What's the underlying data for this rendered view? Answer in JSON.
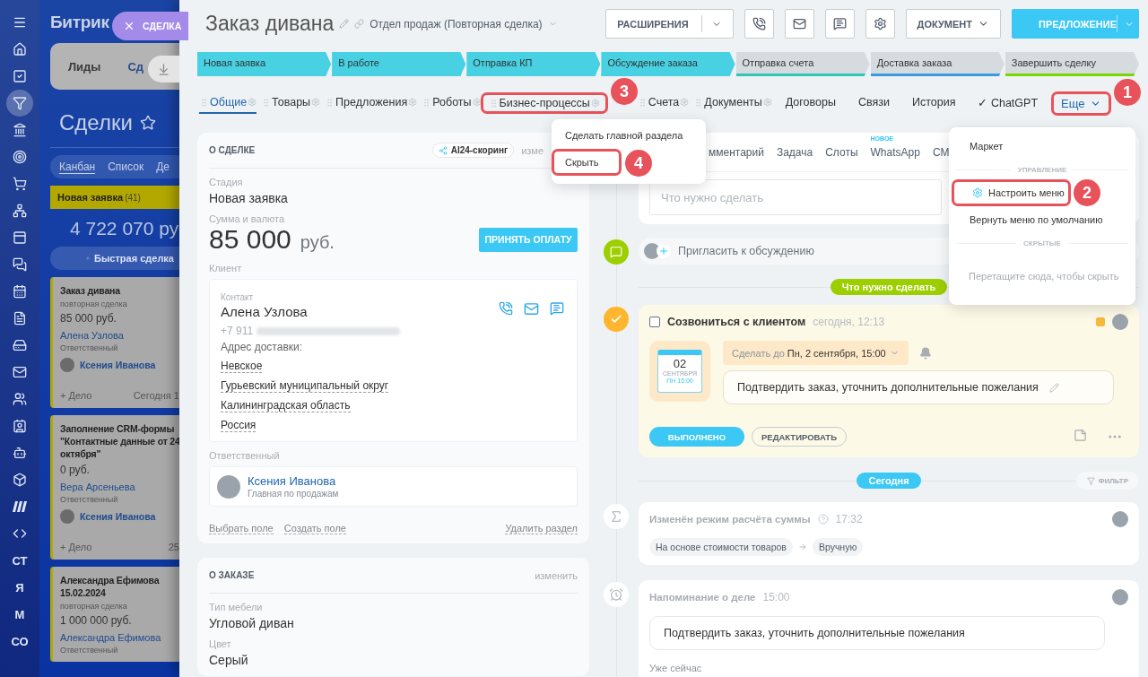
{
  "background_page": {
    "logo": "Битрик",
    "close_tab": {
      "label": "СДЕЛКА"
    },
    "rail": [
      {
        "kind": "icon",
        "selected": false
      },
      {
        "kind": "icon",
        "selected": false
      },
      {
        "kind": "icon",
        "selected": false
      },
      {
        "kind": "icon",
        "selected": true
      },
      {
        "kind": "icon",
        "selected": false
      },
      {
        "kind": "icon",
        "selected": false
      },
      {
        "kind": "icon",
        "selected": false
      },
      {
        "kind": "icon",
        "selected": false
      },
      {
        "kind": "icon",
        "selected": false
      },
      {
        "kind": "icon",
        "selected": false
      },
      {
        "kind": "icon",
        "selected": false
      },
      {
        "kind": "icon",
        "selected": false
      },
      {
        "kind": "icon",
        "selected": false
      },
      {
        "kind": "icon",
        "selected": false
      },
      {
        "kind": "icon",
        "selected": false
      },
      {
        "kind": "icon",
        "selected": false
      },
      {
        "kind": "icon",
        "selected": false
      },
      {
        "kind": "icon",
        "selected": false
      },
      {
        "kind": "icon",
        "selected": false
      },
      {
        "kind": "icon",
        "selected": false
      },
      {
        "kind": "text",
        "label": "СТ",
        "selected": false
      },
      {
        "kind": "text",
        "label": "Я",
        "selected": false
      },
      {
        "kind": "text",
        "label": "М",
        "selected": false
      },
      {
        "kind": "text",
        "label": "СО",
        "selected": false
      }
    ],
    "entity_tabs": [
      {
        "label": "Лиды",
        "selected": false
      },
      {
        "label": "Сд",
        "selected": true
      }
    ],
    "title": "Сделки",
    "view_tabs": [
      {
        "label": "Канбан",
        "selected": true
      },
      {
        "label": "Список",
        "selected": false
      },
      {
        "label": "Де",
        "selected": false
      }
    ],
    "column": {
      "title": "Новая заявка",
      "count": "(41)",
      "total": "4 722 070 ру",
      "quick_add": "Быстрая сделка"
    },
    "cards": [
      {
        "title_lines": [
          "Заказ дивана"
        ],
        "subtitle": "повторная сделка",
        "amount": "85 000 руб.",
        "client": "Алена Узлова",
        "responsible_label": "Ответственный",
        "responsible": "Ксения Иванова",
        "add": "+ Дело",
        "date": "Сегодня 1"
      },
      {
        "title_lines": [
          "Заполнение CRM-формы",
          "\"Контактные данные от 24",
          "октября\""
        ],
        "amount": "0 руб.",
        "client": "Вера Арсеньева",
        "responsible_label": "Ответственный",
        "responsible": "Ксения Иванова",
        "add": "+ Дело",
        "date": "25"
      },
      {
        "title_lines": [
          "Александра Ефимова",
          "15.02.2024"
        ],
        "subtitle": "повторная сделка",
        "amount": "1 000 000 руб.",
        "client": "Александра Ефимова",
        "responsible_label": "Ответственный"
      }
    ]
  },
  "header": {
    "title": "Заказ дивана",
    "category": "Отдел продаж (Повторная сделка)",
    "extensions": "РАСШИРЕНИЯ",
    "document": "ДОКУМЕНТ",
    "proposal": "ПРЕДЛОЖЕНИЕ"
  },
  "stages": [
    {
      "label": "Новая заявка",
      "passed": true,
      "color": "#47d1e2"
    },
    {
      "label": "В работе",
      "passed": true,
      "color": "#47d1e2"
    },
    {
      "label": "Отправка КП",
      "passed": true,
      "color": "#47d1e2"
    },
    {
      "label": "Обсуждение заказа",
      "passed": true,
      "color": "#47d1e2"
    },
    {
      "label": "Отправка счета",
      "passed": false,
      "color": "#2fc6b6"
    },
    {
      "label": "Доставка заказа",
      "passed": false,
      "color": "#3a9be0"
    },
    {
      "label": "Завершить сделку",
      "passed": false,
      "color": "#7bd500"
    }
  ],
  "tabs": [
    {
      "label": "Общие",
      "selected": true,
      "configurable": true
    },
    {
      "label": "Товары",
      "selected": false,
      "configurable": true
    },
    {
      "label": "Предложения",
      "selected": false,
      "configurable": true
    },
    {
      "label": "Роботы",
      "selected": false,
      "configurable": true
    },
    {
      "label": "Бизнес-процессы",
      "selected": false,
      "configurable": true,
      "highlighted": true,
      "step": "3"
    },
    {
      "label": "Счета",
      "selected": false,
      "configurable": true
    },
    {
      "label": "Документы",
      "selected": false,
      "configurable": true
    },
    {
      "label": "Договоры",
      "selected": false,
      "configurable": false
    },
    {
      "label": "Связи",
      "selected": false,
      "configurable": false
    },
    {
      "label": "История",
      "selected": false,
      "configurable": false
    },
    {
      "label": "✓ ChatGPT",
      "selected": false,
      "configurable": false
    }
  ],
  "more_tab": {
    "label": "Еще",
    "highlighted": true,
    "step": "1"
  },
  "deal_section": {
    "title": "О СДЕЛКЕ",
    "scoring": "AI24-скоринг",
    "edit": "изме",
    "stage_label": "Стадия",
    "stage": "Новая заявка",
    "sum_label": "Сумма и валюта",
    "sum": "85 000",
    "currency": "руб.",
    "pay_button": "ПРИНЯТЬ ОПЛАТУ",
    "client_label": "Клиент",
    "contact": {
      "label": "Контакт",
      "name": "Алена Узлова",
      "phone": "+7 911",
      "address_label": "Адрес доставки:",
      "address_lines": [
        "Невское",
        "Гурьевский муниципальный округ",
        "Калининградская область",
        "Россия"
      ]
    },
    "responsible_label": "Ответственный",
    "responsible": {
      "name": "Ксения Иванова",
      "role": "Главная по продажам"
    },
    "links": [
      "Выбрать поле",
      "Создать поле"
    ],
    "delete_link": "Удалить раздел"
  },
  "order_section": {
    "title": "О ЗАКАЗЕ",
    "edit": "изменить",
    "fields": [
      {
        "label": "Тип мебели",
        "value": "Угловой диван"
      },
      {
        "label": "Цвет",
        "value": "Серый"
      }
    ]
  },
  "composer": {
    "tabs": [
      {
        "label": "мментарий"
      },
      {
        "label": "Задача"
      },
      {
        "label": "Слоты"
      },
      {
        "label": "WhatsApp",
        "badge": "НОВОЕ"
      },
      {
        "label": "СМ"
      }
    ],
    "placeholder": "Что нужно сделать"
  },
  "invite": "Пригласить к обсуждению",
  "todo_divider": "Что нужно сделать",
  "activity": {
    "checked": false,
    "title": "Созвониться с клиентом",
    "time": "сегодня, 12:13",
    "day": "02",
    "month": "СЕНТЯБРЯ",
    "weekday_time": "ПН 15:00",
    "deadline": "Сделать до **Пн, 2 сентября, 15:00**",
    "comment": "Подтвердить заказ, уточнить дополнительные пожелания",
    "done_button": "ВЫПОЛНЕНО",
    "edit_button": "РЕДАКТИРОВАТЬ"
  },
  "today_divider": "Сегодня",
  "filter": "ФИЛЬТР",
  "history": [
    {
      "kind": "change",
      "title": "Изменён режим расчёта суммы",
      "time": "17:32",
      "from": "На основе стоимости товаров",
      "to": "Вручную"
    },
    {
      "kind": "reminder",
      "title": "Напоминание о деле",
      "time": "15:00",
      "text": "Подтвердить заказ, уточнить дополнительные пожелания",
      "footer": "Уже сейчас"
    }
  ],
  "tab_menu": [
    {
      "label": "Сделать главной раздела",
      "highlighted": false
    },
    {
      "label": "Скрыть",
      "highlighted": true,
      "step": "4"
    }
  ],
  "more_menu": [
    {
      "kind": "item",
      "label": "Маркет"
    },
    {
      "kind": "section",
      "label": "УПРАВЛЕНИЕ"
    },
    {
      "kind": "setting",
      "label": "Настроить меню",
      "highlighted": true,
      "step": "2"
    },
    {
      "kind": "item",
      "label": "Вернуть меню по умолчанию"
    },
    {
      "kind": "section",
      "label": "СКРЫТЫЕ"
    },
    {
      "kind": "hint",
      "label": "Перетащите сюда, чтобы скрыть"
    }
  ]
}
